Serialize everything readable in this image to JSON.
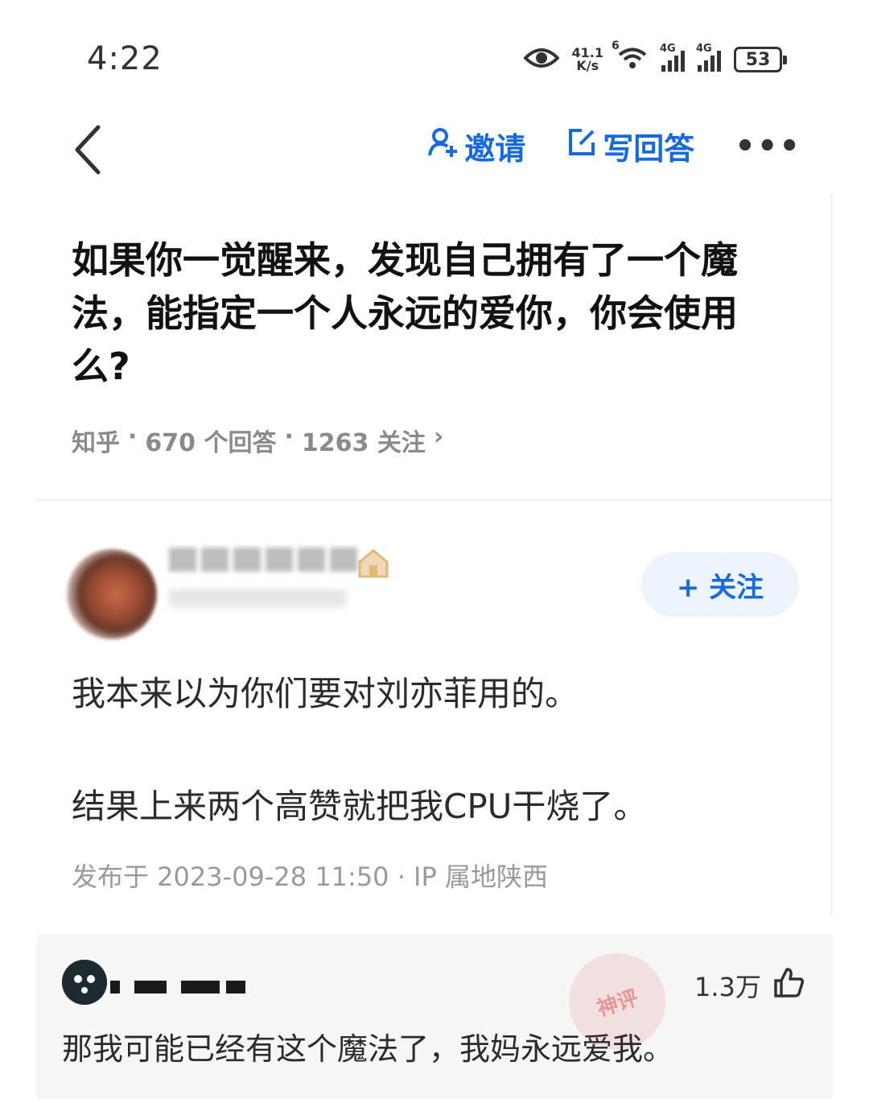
{
  "status_bar": {
    "time": "4:22",
    "net_speed_value": "41.1",
    "net_speed_unit": "K/s",
    "wifi_label": "6",
    "sim1_label": "4G",
    "sim2_label": "4G",
    "battery": "53"
  },
  "nav": {
    "invite_label": "邀请",
    "write_answer_label": "写回答",
    "more_label": "•••"
  },
  "question": {
    "title": "如果你一觉醒来，发现自己拥有了一个魔法，能指定一个人永远的爱你，你会使用么?",
    "source": "知乎",
    "answers_count": "670 个回答",
    "followers_count": "1263 关注",
    "sep": "·",
    "chevron": "›"
  },
  "answer": {
    "follow_label": "+ 关注",
    "line1": "我本来以为你们要对刘亦菲用的。",
    "line2": "结果上来两个高赞就把我CPU干烧了。",
    "publish_info": "发布于 2023-09-28 11:50 · IP 属地陕西"
  },
  "comment": {
    "likes": "1.3万",
    "text": "那我可能已经有这个魔法了，我妈永远爱我。",
    "watermark": "神评"
  },
  "colors": {
    "accent": "#1769e0",
    "follow_bg": "#eef4fd",
    "meta_gray": "#8a8a8a",
    "comment_bg": "#f6f6f6"
  },
  "icons": [
    "back-chevron-icon",
    "person-add-icon",
    "edit-icon",
    "more-icon",
    "eye-icon",
    "wifi-icon",
    "signal-icon",
    "battery-icon",
    "thumbs-up-icon",
    "badge-icon"
  ]
}
